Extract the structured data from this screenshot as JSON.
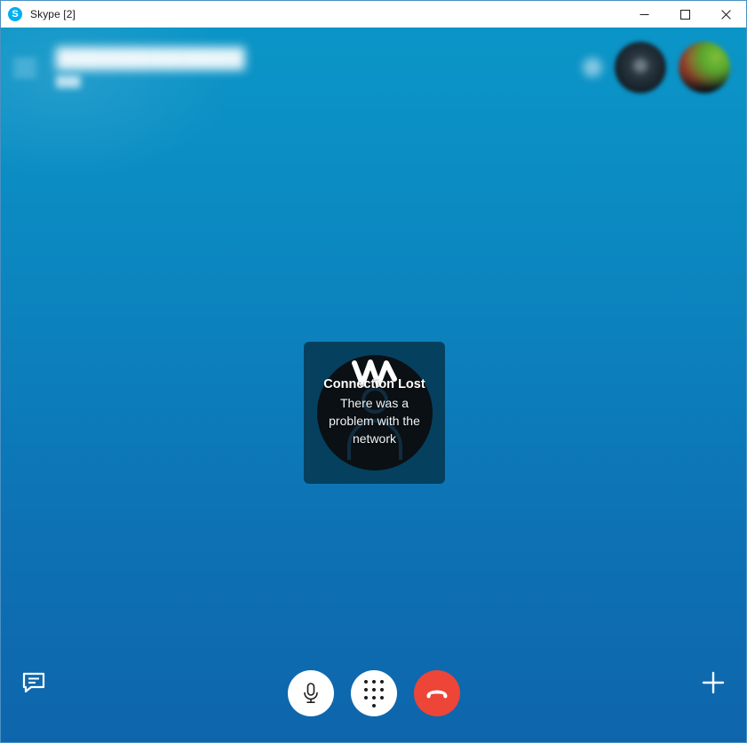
{
  "window": {
    "title": "Skype [2]",
    "logo_icon": "skype-logo-icon",
    "controls": {
      "minimize_label": "Minimize",
      "maximize_label": "Maximize",
      "close_label": "Close"
    }
  },
  "header": {
    "menu_icon": "hamburger-menu-icon",
    "contact_name": "████████████",
    "contact_status": "███",
    "info_icon": "info-icon",
    "avatar_dark_label": "Participant avatar",
    "avatar_photo_label": "Participant avatar"
  },
  "call_card": {
    "icon": "connection-lost-wave-icon",
    "avatar_icon": "default-person-icon",
    "title": "Connection Lost",
    "message": "There was a problem with the network"
  },
  "controls": {
    "chat_label": "Chat",
    "chat_icon": "chat-bubble-icon",
    "mic_label": "Mute microphone",
    "mic_icon": "microphone-icon",
    "dialpad_label": "Dial pad",
    "dialpad_icon": "dialpad-icon",
    "end_call_label": "End call",
    "end_call_icon": "hang-up-phone-icon",
    "add_label": "Add people",
    "add_icon": "plus-icon"
  },
  "colors": {
    "background_top": "#0b95c7",
    "background_bottom": "#0e65ab",
    "card_background": "#05405f",
    "card_circle": "#0b1014",
    "end_call_red": "#ed4537",
    "button_white": "#ffffff",
    "skype_blue": "#00aff0",
    "window_border": "#4a90c2"
  }
}
